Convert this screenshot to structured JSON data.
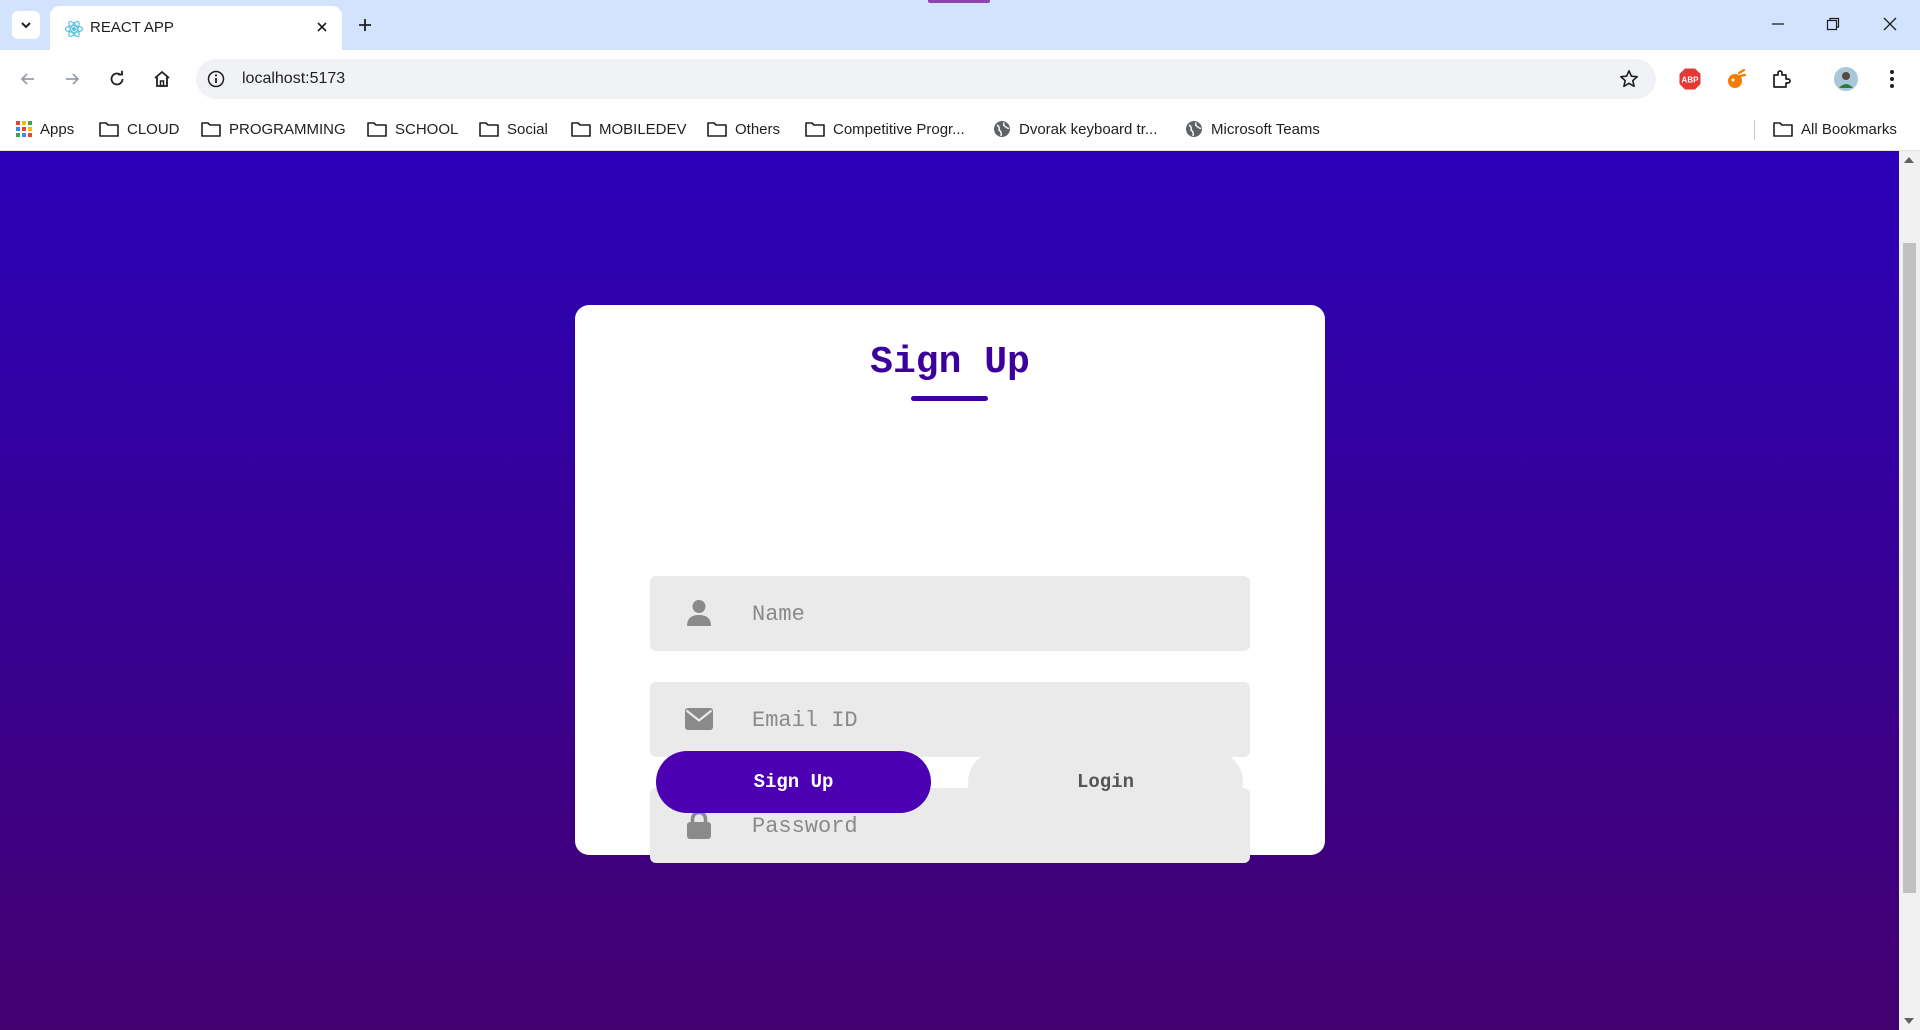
{
  "browser": {
    "tab_title": "REACT APP",
    "url": "localhost:5173",
    "bookmarks": [
      {
        "label": "Apps",
        "icon": "apps-grid-icon"
      },
      {
        "label": "CLOUD",
        "icon": "folder-icon"
      },
      {
        "label": "PROGRAMMING",
        "icon": "folder-icon"
      },
      {
        "label": "SCHOOL",
        "icon": "folder-icon"
      },
      {
        "label": "Social",
        "icon": "folder-icon"
      },
      {
        "label": "MOBILEDEV",
        "icon": "folder-icon"
      },
      {
        "label": "Others",
        "icon": "folder-icon"
      },
      {
        "label": "Competitive Progr...",
        "icon": "folder-icon"
      },
      {
        "label": "Dvorak keyboard tr...",
        "icon": "globe-icon"
      },
      {
        "label": "Microsoft Teams",
        "icon": "globe-icon"
      }
    ],
    "all_bookmarks": "All Bookmarks"
  },
  "form": {
    "title": "Sign Up",
    "fields": [
      {
        "placeholder": "Name",
        "icon": "user-icon",
        "type": "text"
      },
      {
        "placeholder": "Email ID",
        "icon": "envelope-icon",
        "type": "email"
      },
      {
        "placeholder": "Password",
        "icon": "lock-icon",
        "type": "password"
      }
    ],
    "signup_label": "Sign Up",
    "login_label": "Login"
  },
  "colors": {
    "gradient_top": "#2c02b9",
    "gradient_bottom": "#43006f",
    "accent": "#3c009d",
    "primary_button": "#4c00b4"
  }
}
